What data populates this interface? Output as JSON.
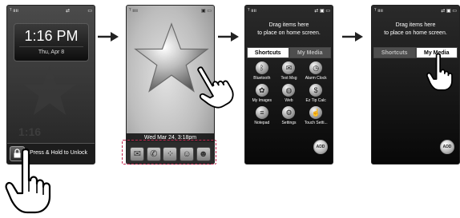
{
  "screen1": {
    "status_left": "ᵀ ıııı",
    "status_mid": "⇄",
    "status_right": "▭",
    "clock_time": "1:16 PM",
    "clock_date": "Thu, Apr 8",
    "ghost_time": "1:16",
    "unlock_label": "Press & Hold to Unlock"
  },
  "screen2": {
    "status_left": "ᵀ ıııı",
    "status_right": "▣ ▭",
    "date_bar": "Wed Mar 24, 3:18pm",
    "dock_icons": [
      "envelope-icon",
      "phone-icon",
      "menu-grid-icon",
      "contact-icon",
      "contacts-icon"
    ]
  },
  "screen3": {
    "status_left": "ᵀ ıııı",
    "status_right": "⇄ ▣ ▭",
    "drag_line1": "Drag items here",
    "drag_line2": "to place on home screen.",
    "tab_shortcuts": "Shortcuts",
    "tab_my_media": "My Media",
    "items": [
      {
        "label": "Bluetooth",
        "icon": "bluetooth-icon",
        "glyph": "ᛒ"
      },
      {
        "label": "Text Msg",
        "icon": "text-message-icon",
        "glyph": "✉"
      },
      {
        "label": "Alarm Clock",
        "icon": "alarm-clock-icon",
        "glyph": "◷"
      },
      {
        "label": "My Images",
        "icon": "my-images-icon",
        "glyph": "✿"
      },
      {
        "label": "Web",
        "icon": "web-icon",
        "glyph": "◍"
      },
      {
        "label": "Ez Tip Calc",
        "icon": "tip-calculator-icon",
        "glyph": "$"
      },
      {
        "label": "Notepad",
        "icon": "notepad-icon",
        "glyph": "≡"
      },
      {
        "label": "Settings",
        "icon": "settings-icon",
        "glyph": "⚙"
      },
      {
        "label": "Touch Setti...",
        "icon": "touch-settings-icon",
        "glyph": "☝"
      }
    ],
    "add_label": "ADD"
  },
  "screen4": {
    "status_left": "ᵀ ıııı",
    "status_right": "⇄ ▣ ▭",
    "drag_line1": "Drag items here",
    "drag_line2": "to place on home screen.",
    "tab_shortcuts": "Shortcuts",
    "tab_my_media": "My Media",
    "add_label": "ADD"
  },
  "colors": {
    "dock_highlight": "#c2244e",
    "arrow": "#222222"
  }
}
